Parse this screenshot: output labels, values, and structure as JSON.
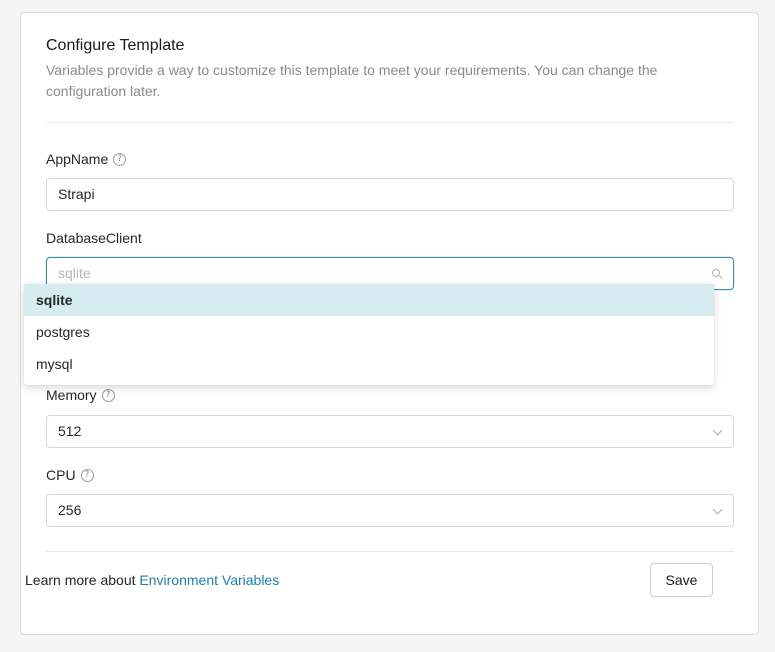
{
  "header": {
    "title": "Configure Template",
    "description": "Variables provide a way to customize this template to meet your requirements. You can change the configuration later."
  },
  "fields": {
    "app_name": {
      "label": "AppName",
      "value": "Strapi"
    },
    "database_client": {
      "label": "DatabaseClient",
      "placeholder": "sqlite",
      "options": [
        "sqlite",
        "postgres",
        "mysql"
      ],
      "selected": "sqlite"
    },
    "memory": {
      "label": "Memory",
      "value": "512"
    },
    "cpu": {
      "label": "CPU",
      "value": "256"
    }
  },
  "footer": {
    "text": "Learn more about ",
    "link": "Environment Variables",
    "save_label": "Save"
  },
  "colors": {
    "accent": "#1f7fa6",
    "selected_bg": "#d5ecf1",
    "focus_border": "#3a8fa6"
  }
}
